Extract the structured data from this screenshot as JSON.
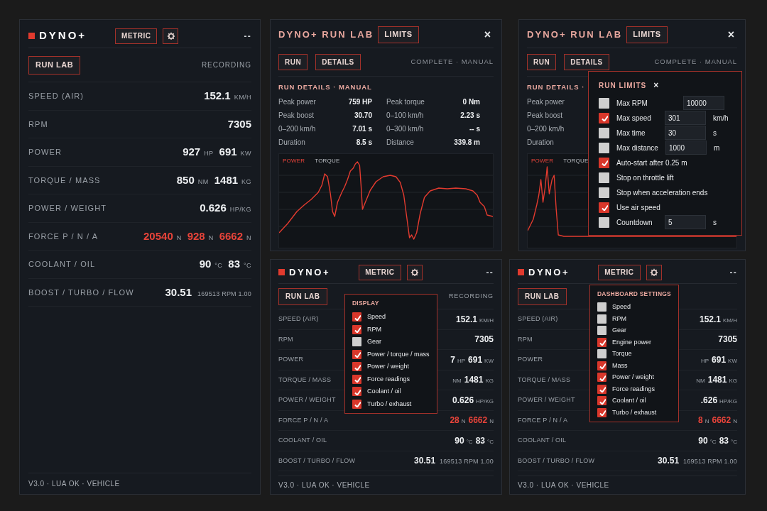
{
  "panels": [
    {
      "kind": "dashboard",
      "title": "DYNO+",
      "mode_button": "METRIC",
      "status": "--",
      "run_lab_button": "RUN LAB",
      "recording": "RECORDING",
      "rows": [
        {
          "label": "SPEED (AIR)",
          "values": [
            {
              "kind": "value",
              "text": "152.1"
            },
            {
              "kind": "unit",
              "text": "KM/H"
            }
          ]
        },
        {
          "label": "RPM",
          "values": [
            {
              "kind": "value",
              "text": "7305"
            }
          ]
        },
        {
          "label": "POWER",
          "values": [
            {
              "kind": "value",
              "text": "927"
            },
            {
              "kind": "unit",
              "text": "HP"
            },
            {
              "kind": "value",
              "text": "691"
            },
            {
              "kind": "unit",
              "text": "KW"
            }
          ]
        },
        {
          "label": "TORQUE / MASS",
          "values": [
            {
              "kind": "value",
              "text": "850"
            },
            {
              "kind": "unit",
              "text": "NM"
            },
            {
              "kind": "value",
              "text": "1481"
            },
            {
              "kind": "unit",
              "text": "KG"
            }
          ]
        },
        {
          "label": "POWER / WEIGHT",
          "values": [
            {
              "kind": "value",
              "text": "0.626"
            },
            {
              "kind": "unit",
              "text": "HP/KG"
            }
          ]
        },
        {
          "label": "FORCE P / N / A",
          "values": [
            {
              "kind": "alert",
              "text": "20540"
            },
            {
              "kind": "unit",
              "text": "N"
            },
            {
              "kind": "alert",
              "text": "928"
            },
            {
              "kind": "unit",
              "text": "N"
            },
            {
              "kind": "alert",
              "text": "6662"
            },
            {
              "kind": "unit",
              "text": "N"
            }
          ]
        },
        {
          "label": "COOLANT / OIL",
          "values": [
            {
              "kind": "value",
              "text": "90"
            },
            {
              "kind": "unit",
              "text": "°C"
            },
            {
              "kind": "value",
              "text": "83"
            },
            {
              "kind": "unit",
              "text": "°C"
            }
          ]
        },
        {
          "label": "BOOST / TURBO / FLOW",
          "values": [
            {
              "kind": "value",
              "text": "30.51"
            },
            {
              "kind": "minor",
              "text": "169513 RPM 1.00"
            }
          ]
        }
      ],
      "footer": "V3.0 · LUA OK · VEHICLE"
    },
    {
      "kind": "run_lab",
      "title": "DYNO+ RUN LAB",
      "limits_button": "LIMITS",
      "close": "×",
      "run_button": "RUN",
      "details_button": "DETAILS",
      "status": "COMPLETE · MANUAL",
      "details_title": "RUN DETAILS · MANUAL",
      "stats_left": [
        {
          "label": "Peak power",
          "value": "759 HP"
        },
        {
          "label": "Peak boost",
          "value": "30.70"
        },
        {
          "label": "0–200 km/h",
          "value": "7.01 s"
        },
        {
          "label": "Duration",
          "value": "8.5 s"
        }
      ],
      "stats_right": [
        {
          "label": "Peak torque",
          "value": "0 Nm"
        },
        {
          "label": "0–100 km/h",
          "value": "2.23 s"
        },
        {
          "label": "0–300 km/h",
          "value": "-- s"
        },
        {
          "label": "Distance",
          "value": "339.8 m"
        }
      ],
      "legend": [
        {
          "label": "POWER",
          "selected": true
        },
        {
          "label": "TORQUE",
          "selected": false
        }
      ]
    },
    {
      "kind": "run_lab",
      "title": "DYNO+ RUN LAB",
      "limits_button": "LIMITS",
      "close": "×",
      "run_button": "RUN",
      "details_button": "DETAILS",
      "status": "COMPLETE · MANUAL",
      "details_title": "RUN DETAILS ·",
      "stats_left": [
        {
          "label": "Peak power"
        },
        {
          "label": "Peak boost"
        },
        {
          "label": "0–200 km/h"
        },
        {
          "label": "Duration"
        }
      ],
      "legend": [
        {
          "label": "POWER",
          "selected": true
        },
        {
          "label": "TORQUE",
          "selected": false
        }
      ],
      "popup": {
        "title": "RUN LIMITS",
        "close": "×",
        "items": [
          {
            "label": "Max RPM",
            "checked": false,
            "value": "10000"
          },
          {
            "label": "Max speed",
            "checked": true,
            "value": "301",
            "unit": "km/h"
          },
          {
            "label": "Max time",
            "checked": false,
            "value": "30",
            "unit": "s"
          },
          {
            "label": "Max distance",
            "checked": false,
            "value": "1000",
            "unit": "m"
          },
          {
            "label": "Auto-start after 0.25 m",
            "checked": true
          },
          {
            "label": "Stop on throttle lift",
            "checked": false
          },
          {
            "label": "Stop when acceleration ends",
            "checked": false
          },
          {
            "label": "Use air speed",
            "checked": true
          },
          {
            "label": "Countdown",
            "checked": false,
            "value": "5",
            "unit": "s"
          }
        ]
      }
    },
    {
      "kind": "dashboard",
      "title": "DYNO+",
      "mode_button": "METRIC",
      "status": "--",
      "run_lab_button": "RUN LAB",
      "recording": "RECORDING",
      "rows": [
        {
          "label": "SPEED (AIR)",
          "values": [
            {
              "kind": "value",
              "text": "152.1"
            },
            {
              "kind": "unit",
              "text": "KM/H"
            }
          ]
        },
        {
          "label": "RPM",
          "values": [
            {
              "kind": "value",
              "text": "7305"
            }
          ]
        },
        {
          "label": "POWER",
          "values": [
            {
              "kind": "value",
              "text": "7"
            },
            {
              "kind": "unit",
              "text": "HP"
            },
            {
              "kind": "value",
              "text": "691"
            },
            {
              "kind": "unit",
              "text": "KW"
            }
          ]
        },
        {
          "label": "TORQUE / MASS",
          "values": [
            {
              "kind": "unit",
              "text": "NM"
            },
            {
              "kind": "value",
              "text": "1481"
            },
            {
              "kind": "unit",
              "text": "KG"
            }
          ]
        },
        {
          "label": "POWER / WEIGHT",
          "values": [
            {
              "kind": "value",
              "text": "0.626"
            },
            {
              "kind": "unit",
              "text": "HP/KG"
            }
          ]
        },
        {
          "label": "FORCE P / N / A",
          "values": [
            {
              "kind": "alert",
              "text": "28"
            },
            {
              "kind": "unit",
              "text": "N"
            },
            {
              "kind": "alert",
              "text": "6662"
            },
            {
              "kind": "unit",
              "text": "N"
            }
          ]
        },
        {
          "label": "COOLANT / OIL",
          "values": [
            {
              "kind": "value",
              "text": "90"
            },
            {
              "kind": "unit",
              "text": "°C"
            },
            {
              "kind": "value",
              "text": "83"
            },
            {
              "kind": "unit",
              "text": "°C"
            }
          ]
        },
        {
          "label": "BOOST / TURBO / FLOW",
          "values": [
            {
              "kind": "value",
              "text": "30.51"
            },
            {
              "kind": "minor",
              "text": "169513 RPM 1.00"
            }
          ]
        }
      ],
      "footer": "V3.0 · LUA OK · VEHICLE",
      "popup": {
        "title": "DISPLAY",
        "items": [
          {
            "label": "Speed",
            "checked": true
          },
          {
            "label": "RPM",
            "checked": true
          },
          {
            "label": "Gear",
            "checked": false
          },
          {
            "label": "Power / torque / mass",
            "checked": true
          },
          {
            "label": "Power / weight",
            "checked": true
          },
          {
            "label": "Force readings",
            "checked": true
          },
          {
            "label": "Coolant / oil",
            "checked": true
          },
          {
            "label": "Turbo / exhaust",
            "checked": true
          }
        ]
      }
    },
    {
      "kind": "dashboard",
      "title": "DYNO+",
      "mode_button": "METRIC",
      "status": "--",
      "run_lab_button": "RUN LAB",
      "rows": [
        {
          "label": "SPEED (AIR)",
          "values": [
            {
              "kind": "value",
              "text": "152.1"
            },
            {
              "kind": "unit",
              "text": "KM/H"
            }
          ]
        },
        {
          "label": "RPM",
          "values": [
            {
              "kind": "value",
              "text": "7305"
            }
          ]
        },
        {
          "label": "POWER",
          "values": [
            {
              "kind": "unit",
              "text": "HP"
            },
            {
              "kind": "value",
              "text": "691"
            },
            {
              "kind": "unit",
              "text": "KW"
            }
          ]
        },
        {
          "label": "TORQUE / MASS",
          "values": [
            {
              "kind": "unit",
              "text": "NM"
            },
            {
              "kind": "value",
              "text": "1481"
            },
            {
              "kind": "unit",
              "text": "KG"
            }
          ]
        },
        {
          "label": "POWER / WEIGHT",
          "values": [
            {
              "kind": "value",
              "text": ".626"
            },
            {
              "kind": "unit",
              "text": "HP/KG"
            }
          ]
        },
        {
          "label": "FORCE P / N / A",
          "values": [
            {
              "kind": "alert",
              "text": "8"
            },
            {
              "kind": "unit",
              "text": "N"
            },
            {
              "kind": "alert",
              "text": "6662"
            },
            {
              "kind": "unit",
              "text": "N"
            }
          ]
        },
        {
          "label": "COOLANT / OIL",
          "values": [
            {
              "kind": "value",
              "text": "90"
            },
            {
              "kind": "unit",
              "text": "°C"
            },
            {
              "kind": "value",
              "text": "83"
            },
            {
              "kind": "unit",
              "text": "°C"
            }
          ]
        },
        {
          "label": "BOOST / TURBO / FLOW",
          "values": [
            {
              "kind": "value",
              "text": "30.51"
            },
            {
              "kind": "minor",
              "text": "169513 RPM 1.00"
            }
          ]
        }
      ],
      "footer": "V3.0 · LUA OK · VEHICLE",
      "popup": {
        "title": "DASHBOARD SETTINGS",
        "items": [
          {
            "label": "Speed",
            "checked": false
          },
          {
            "label": "RPM",
            "checked": false
          },
          {
            "label": "Gear",
            "checked": false
          },
          {
            "label": "Engine power",
            "checked": true
          },
          {
            "label": "Torque",
            "checked": false
          },
          {
            "label": "Mass",
            "checked": true
          },
          {
            "label": "Power / weight",
            "checked": true
          },
          {
            "label": "Force readings",
            "checked": true
          },
          {
            "label": "Coolant / oil",
            "checked": true
          },
          {
            "label": "Turbo / exhaust",
            "checked": true
          }
        ]
      }
    }
  ]
}
